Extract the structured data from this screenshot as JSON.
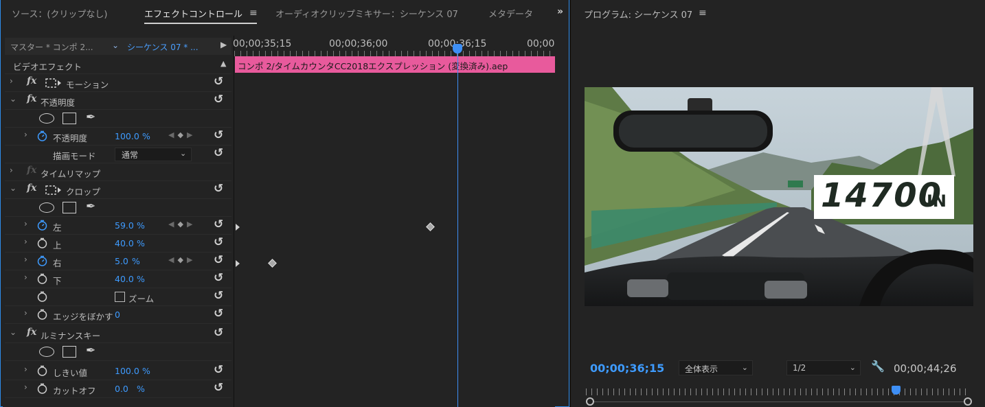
{
  "tabs": {
    "source": "ソース：(クリップなし)",
    "effect_controls": "エフェクトコントロール",
    "audio_mixer": "オーディオクリップミキサー：シーケンス 07",
    "metadata": "メタデータ"
  },
  "effect_controls": {
    "master_label": "マスター * コンポ 2...",
    "sequence_label": "シーケンス 07 * ...",
    "video_effects_label": "ビデオエフェクト",
    "rows": [
      {
        "label": "モーション"
      },
      {
        "label": "不透明度"
      },
      {
        "label": "不透明度",
        "value": "100.0",
        "unit": "%"
      },
      {
        "label": "描画モード",
        "select_value": "通常"
      },
      {
        "label": "タイムリマップ"
      },
      {
        "label": "クロップ"
      },
      {
        "label": "左",
        "value": "59.0",
        "unit": "%"
      },
      {
        "label": "上",
        "value": "40.0",
        "unit": "%"
      },
      {
        "label": "右",
        "value": "5.0",
        "unit": "%"
      },
      {
        "label": "下",
        "value": "40.0",
        "unit": "%"
      },
      {
        "label": "ズーム",
        "checked": false
      },
      {
        "label": "エッジをぼかす",
        "value": "0"
      },
      {
        "label": "ルミナンスキー"
      },
      {
        "label": "しきい値",
        "value": "100.0",
        "unit": "%"
      },
      {
        "label": "カットオフ",
        "value": "0.0",
        "unit": "%"
      }
    ]
  },
  "timeline": {
    "timecodes": [
      "00;00;35;15",
      "00;00;36;00",
      "00;00;36;15",
      "00;00"
    ],
    "clip_name": "コンポ 2/タイムカウンタCC2018エクスプレッション (変換済み).aep",
    "clip_color": "#e85a9c",
    "playhead_color": "#3e8ff5"
  },
  "program": {
    "title": "プログラム: シーケンス 07",
    "timecode": "00;00;36;15",
    "zoom_select": "全体表示",
    "resolution_select": "1/2",
    "duration": "00;00;44;26",
    "video_overlay_number": "14700",
    "video_overlay_unit": "IN"
  },
  "colors": {
    "accent_blue": "#3e9bff",
    "panel_bg": "#232323"
  },
  "icons": [
    "menu-icon",
    "panel-overflow-icon",
    "stopwatch-icon",
    "reset-icon",
    "ellipse-mask-icon",
    "rectangle-mask-icon",
    "pen-mask-icon",
    "wrench-icon",
    "chevron-down-icon"
  ]
}
